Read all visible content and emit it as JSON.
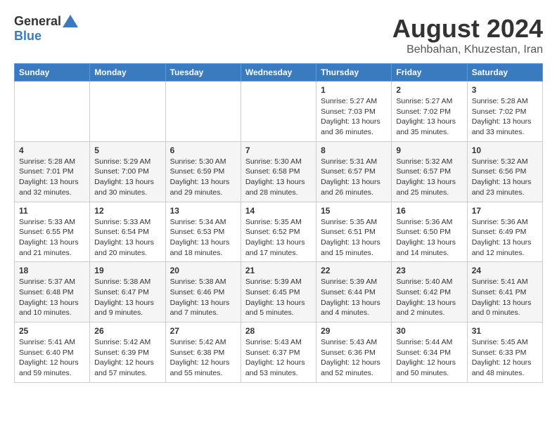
{
  "header": {
    "logo_general": "General",
    "logo_blue": "Blue",
    "title": "August 2024",
    "location": "Behbahan, Khuzestan, Iran"
  },
  "days_of_week": [
    "Sunday",
    "Monday",
    "Tuesday",
    "Wednesday",
    "Thursday",
    "Friday",
    "Saturday"
  ],
  "weeks": [
    [
      {
        "day": "",
        "info": ""
      },
      {
        "day": "",
        "info": ""
      },
      {
        "day": "",
        "info": ""
      },
      {
        "day": "",
        "info": ""
      },
      {
        "day": "1",
        "info": "Sunrise: 5:27 AM\nSunset: 7:03 PM\nDaylight: 13 hours\nand 36 minutes."
      },
      {
        "day": "2",
        "info": "Sunrise: 5:27 AM\nSunset: 7:02 PM\nDaylight: 13 hours\nand 35 minutes."
      },
      {
        "day": "3",
        "info": "Sunrise: 5:28 AM\nSunset: 7:02 PM\nDaylight: 13 hours\nand 33 minutes."
      }
    ],
    [
      {
        "day": "4",
        "info": "Sunrise: 5:28 AM\nSunset: 7:01 PM\nDaylight: 13 hours\nand 32 minutes."
      },
      {
        "day": "5",
        "info": "Sunrise: 5:29 AM\nSunset: 7:00 PM\nDaylight: 13 hours\nand 30 minutes."
      },
      {
        "day": "6",
        "info": "Sunrise: 5:30 AM\nSunset: 6:59 PM\nDaylight: 13 hours\nand 29 minutes."
      },
      {
        "day": "7",
        "info": "Sunrise: 5:30 AM\nSunset: 6:58 PM\nDaylight: 13 hours\nand 28 minutes."
      },
      {
        "day": "8",
        "info": "Sunrise: 5:31 AM\nSunset: 6:57 PM\nDaylight: 13 hours\nand 26 minutes."
      },
      {
        "day": "9",
        "info": "Sunrise: 5:32 AM\nSunset: 6:57 PM\nDaylight: 13 hours\nand 25 minutes."
      },
      {
        "day": "10",
        "info": "Sunrise: 5:32 AM\nSunset: 6:56 PM\nDaylight: 13 hours\nand 23 minutes."
      }
    ],
    [
      {
        "day": "11",
        "info": "Sunrise: 5:33 AM\nSunset: 6:55 PM\nDaylight: 13 hours\nand 21 minutes."
      },
      {
        "day": "12",
        "info": "Sunrise: 5:33 AM\nSunset: 6:54 PM\nDaylight: 13 hours\nand 20 minutes."
      },
      {
        "day": "13",
        "info": "Sunrise: 5:34 AM\nSunset: 6:53 PM\nDaylight: 13 hours\nand 18 minutes."
      },
      {
        "day": "14",
        "info": "Sunrise: 5:35 AM\nSunset: 6:52 PM\nDaylight: 13 hours\nand 17 minutes."
      },
      {
        "day": "15",
        "info": "Sunrise: 5:35 AM\nSunset: 6:51 PM\nDaylight: 13 hours\nand 15 minutes."
      },
      {
        "day": "16",
        "info": "Sunrise: 5:36 AM\nSunset: 6:50 PM\nDaylight: 13 hours\nand 14 minutes."
      },
      {
        "day": "17",
        "info": "Sunrise: 5:36 AM\nSunset: 6:49 PM\nDaylight: 13 hours\nand 12 minutes."
      }
    ],
    [
      {
        "day": "18",
        "info": "Sunrise: 5:37 AM\nSunset: 6:48 PM\nDaylight: 13 hours\nand 10 minutes."
      },
      {
        "day": "19",
        "info": "Sunrise: 5:38 AM\nSunset: 6:47 PM\nDaylight: 13 hours\nand 9 minutes."
      },
      {
        "day": "20",
        "info": "Sunrise: 5:38 AM\nSunset: 6:46 PM\nDaylight: 13 hours\nand 7 minutes."
      },
      {
        "day": "21",
        "info": "Sunrise: 5:39 AM\nSunset: 6:45 PM\nDaylight: 13 hours\nand 5 minutes."
      },
      {
        "day": "22",
        "info": "Sunrise: 5:39 AM\nSunset: 6:44 PM\nDaylight: 13 hours\nand 4 minutes."
      },
      {
        "day": "23",
        "info": "Sunrise: 5:40 AM\nSunset: 6:42 PM\nDaylight: 13 hours\nand 2 minutes."
      },
      {
        "day": "24",
        "info": "Sunrise: 5:41 AM\nSunset: 6:41 PM\nDaylight: 13 hours\nand 0 minutes."
      }
    ],
    [
      {
        "day": "25",
        "info": "Sunrise: 5:41 AM\nSunset: 6:40 PM\nDaylight: 12 hours\nand 59 minutes."
      },
      {
        "day": "26",
        "info": "Sunrise: 5:42 AM\nSunset: 6:39 PM\nDaylight: 12 hours\nand 57 minutes."
      },
      {
        "day": "27",
        "info": "Sunrise: 5:42 AM\nSunset: 6:38 PM\nDaylight: 12 hours\nand 55 minutes."
      },
      {
        "day": "28",
        "info": "Sunrise: 5:43 AM\nSunset: 6:37 PM\nDaylight: 12 hours\nand 53 minutes."
      },
      {
        "day": "29",
        "info": "Sunrise: 5:43 AM\nSunset: 6:36 PM\nDaylight: 12 hours\nand 52 minutes."
      },
      {
        "day": "30",
        "info": "Sunrise: 5:44 AM\nSunset: 6:34 PM\nDaylight: 12 hours\nand 50 minutes."
      },
      {
        "day": "31",
        "info": "Sunrise: 5:45 AM\nSunset: 6:33 PM\nDaylight: 12 hours\nand 48 minutes."
      }
    ]
  ]
}
